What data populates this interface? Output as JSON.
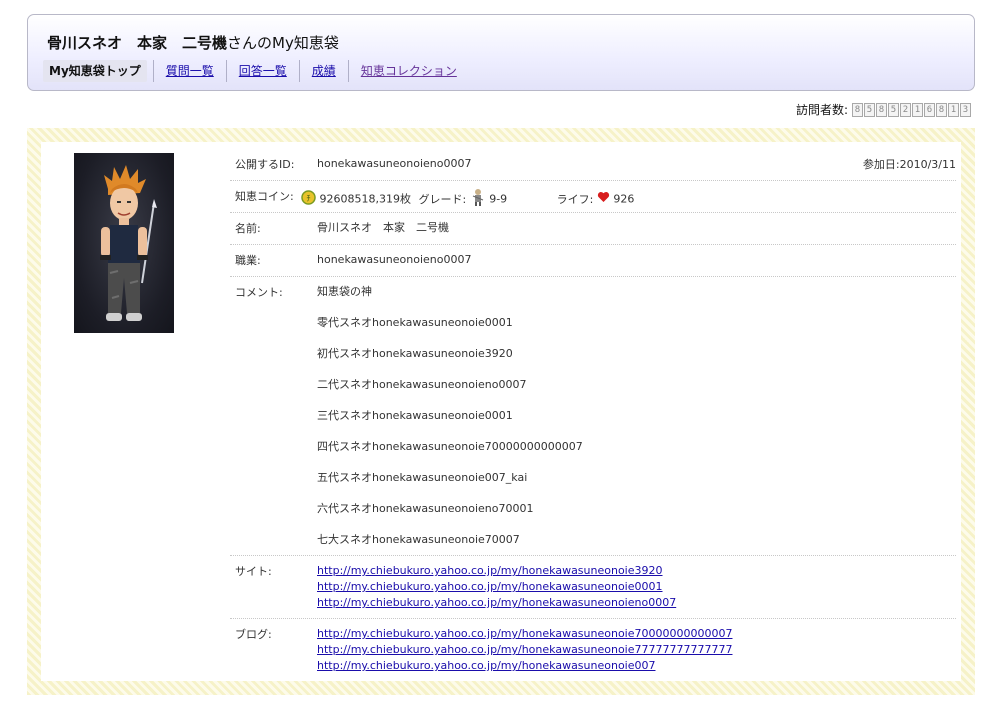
{
  "header": {
    "name": "骨川スネオ　本家　二号機",
    "suffix": "さんのMy知恵袋"
  },
  "tabs": [
    {
      "label": "My知恵袋トップ"
    },
    {
      "label": "質問一覧"
    },
    {
      "label": "回答一覧"
    },
    {
      "label": "成績"
    },
    {
      "label": "知恵コレクション"
    }
  ],
  "visitor": {
    "label": "訪問者数:",
    "digits": [
      "8",
      "5",
      "8",
      "5",
      "2",
      "1",
      "6",
      "8",
      "1",
      "3"
    ]
  },
  "profile": {
    "public_id_label": "公開するID:",
    "public_id": "honekawasuneonoieno0007",
    "join_label": "参加日:",
    "join_date": "2010/3/11",
    "coin_label": "知恵コイン:",
    "coin_value": "92608518,319枚",
    "grade_label": "グレード:",
    "grade_value": "9-9",
    "life_label": "ライフ:",
    "life_value": "926",
    "name_label": "名前:",
    "name_value": "骨川スネオ　本家　二号機",
    "job_label": "職業:",
    "job_value": "honekawasuneonoieno0007",
    "comment_label": "コメント:",
    "comments": [
      "知恵袋の神",
      "零代スネオhonekawasuneonoie0001",
      "初代スネオhonekawasuneonoie3920",
      "二代スネオhonekawasuneonoieno0007",
      "三代スネオhonekawasuneonoie0001",
      "四代スネオhonekawasuneonoie70000000000007",
      "五代スネオhonekawasuneonoie007_kai",
      "六代スネオhonekawasuneonoieno70001",
      "七大スネオhonekawasuneonoie70007"
    ],
    "site_label": "サイト:",
    "sites": [
      "http://my.chiebukuro.yahoo.co.jp/my/honekawasuneonoie3920",
      "http://my.chiebukuro.yahoo.co.jp/my/honekawasuneonoie0001",
      "http://my.chiebukuro.yahoo.co.jp/my/honekawasuneonoieno0007"
    ],
    "blog_label": "ブログ:",
    "blogs": [
      "http://my.chiebukuro.yahoo.co.jp/my/honekawasuneonoie70000000000007",
      "http://my.chiebukuro.yahoo.co.jp/my/honekawasuneonoie77777777777777",
      "http://my.chiebukuro.yahoo.co.jp/my/honekawasuneonoie007"
    ]
  },
  "icons": {
    "coin": "coin-icon",
    "grade": "grade-avatar-icon",
    "life": "heart-icon"
  },
  "colors": {
    "link": "#1a0dab",
    "visited": "#663399",
    "frame": "#f6f2c8",
    "heart": "#d81d1d",
    "coin": "#e8c32a"
  }
}
